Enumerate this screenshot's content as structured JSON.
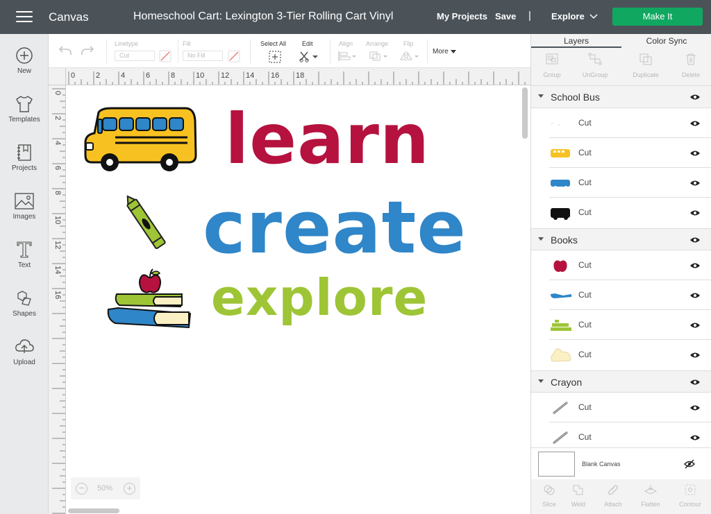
{
  "header": {
    "app_title": "Canvas",
    "doc_title": "Homeschool Cart: Lexington 3-Tier Rolling Cart Vinyl",
    "my_projects": "My Projects",
    "save": "Save",
    "separator": "|",
    "explore": "Explore",
    "make_it": "Make It"
  },
  "sidebar": {
    "items": [
      {
        "label": "New",
        "icon": "plus-circle-icon"
      },
      {
        "label": "Templates",
        "icon": "tshirt-icon"
      },
      {
        "label": "Projects",
        "icon": "projects-icon"
      },
      {
        "label": "Images",
        "icon": "image-icon"
      },
      {
        "label": "Text",
        "icon": "text-icon"
      },
      {
        "label": "Shapes",
        "icon": "shapes-icon"
      },
      {
        "label": "Upload",
        "icon": "upload-icon"
      }
    ]
  },
  "toolbar": {
    "linetype_label": "Linetype",
    "linetype_value": "Cut",
    "fill_label": "Fill",
    "fill_value": "No Fill",
    "select_all": "Select All",
    "edit": "Edit",
    "align": "Align",
    "arrange": "Arrange",
    "flip": "Flip",
    "more": "More"
  },
  "rulers": {
    "top": [
      "0",
      "2",
      "4",
      "6",
      "8",
      "10",
      "12",
      "14",
      "16",
      "18"
    ],
    "left": [
      "0",
      "2",
      "4",
      "6",
      "8",
      "10",
      "12",
      "14",
      "16"
    ]
  },
  "canvas": {
    "words": [
      "learn",
      "create",
      "explore"
    ],
    "colors": {
      "learn": "#b5123f",
      "create": "#2f86c8",
      "explore": "#9ec536",
      "bus": "#f7c221"
    },
    "zoom": "50%",
    "zoom_minus": "−",
    "zoom_plus": "+"
  },
  "panel": {
    "tabs": [
      "Layers",
      "Color Sync"
    ],
    "tools": [
      "Group",
      "UnGroup",
      "Duplicate",
      "Delete"
    ],
    "groups": [
      {
        "name": "School Bus",
        "layers": [
          "Cut",
          "Cut",
          "Cut",
          "Cut"
        ]
      },
      {
        "name": "Books",
        "layers": [
          "Cut",
          "Cut",
          "Cut",
          "Cut"
        ]
      },
      {
        "name": "Crayon",
        "layers": [
          "Cut",
          "Cut"
        ]
      }
    ],
    "blank_canvas": "Blank Canvas",
    "bottom_tools": [
      "Slice",
      "Weld",
      "Attach",
      "Flatten",
      "Contour"
    ]
  }
}
